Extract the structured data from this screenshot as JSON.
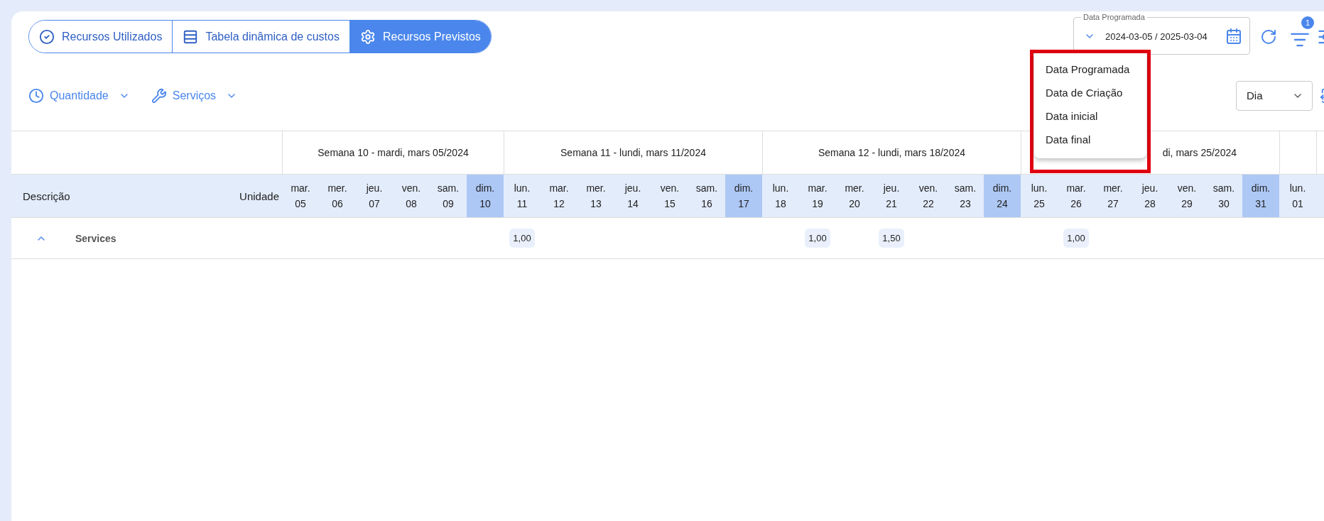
{
  "tabs": [
    {
      "label": "Recursos Utilizados",
      "selected": false
    },
    {
      "label": "Tabela dinâmica de custos",
      "selected": false
    },
    {
      "label": "Recursos Previstos",
      "selected": true
    }
  ],
  "toolbar": [
    "Quantidade",
    "Serviços"
  ],
  "date_filter": {
    "label": "Data Programada",
    "value": "2024-03-05 / 2025-03-04"
  },
  "filter_badge": "1",
  "date_menu": {
    "highlighted": true,
    "items": [
      "Data Programada",
      "Data de Criação",
      "Data inicial",
      "Data final"
    ]
  },
  "period_select": {
    "value": "Dia"
  },
  "table": {
    "columns": [
      "Descrição",
      "Unidade"
    ],
    "weeks": [
      {
        "label": "Semana 10 - mardi, mars 05/2024",
        "days": [
          {
            "weekday": "mar.",
            "day": "05",
            "weekend": false
          },
          {
            "weekday": "mer.",
            "day": "06",
            "weekend": false
          },
          {
            "weekday": "jeu.",
            "day": "07",
            "weekend": false
          },
          {
            "weekday": "ven.",
            "day": "08",
            "weekend": false
          },
          {
            "weekday": "sam.",
            "day": "09",
            "weekend": false
          },
          {
            "weekday": "dim.",
            "day": "10",
            "weekend": true
          }
        ]
      },
      {
        "label": "Semana 11 - lundi, mars 11/2024",
        "days": [
          {
            "weekday": "lun.",
            "day": "11",
            "weekend": false,
            "value": "1,00"
          },
          {
            "weekday": "mar.",
            "day": "12",
            "weekend": false
          },
          {
            "weekday": "mer.",
            "day": "13",
            "weekend": false
          },
          {
            "weekday": "jeu.",
            "day": "14",
            "weekend": false
          },
          {
            "weekday": "ven.",
            "day": "15",
            "weekend": false
          },
          {
            "weekday": "sam.",
            "day": "16",
            "weekend": false
          },
          {
            "weekday": "dim.",
            "day": "17",
            "weekend": true
          }
        ]
      },
      {
        "label": "Semana 12 - lundi, mars 18/2024",
        "days": [
          {
            "weekday": "lun.",
            "day": "18",
            "weekend": false
          },
          {
            "weekday": "mar.",
            "day": "19",
            "weekend": false,
            "value": "1,00"
          },
          {
            "weekday": "mer.",
            "day": "20",
            "weekend": false
          },
          {
            "weekday": "jeu.",
            "day": "21",
            "weekend": false,
            "value": "1,50"
          },
          {
            "weekday": "ven.",
            "day": "22",
            "weekend": false
          },
          {
            "weekday": "sam.",
            "day": "23",
            "weekend": false
          },
          {
            "weekday": "dim.",
            "day": "24",
            "weekend": true
          }
        ]
      },
      {
        "label": "di, mars 25/2024",
        "days": [
          {
            "weekday": "lun.",
            "day": "25",
            "weekend": false
          },
          {
            "weekday": "mar.",
            "day": "26",
            "weekend": false,
            "value": "1,00"
          },
          {
            "weekday": "mer.",
            "day": "27",
            "weekend": false
          },
          {
            "weekday": "jeu.",
            "day": "28",
            "weekend": false
          },
          {
            "weekday": "ven.",
            "day": "29",
            "weekend": false
          },
          {
            "weekday": "sam.",
            "day": "30",
            "weekend": false
          },
          {
            "weekday": "dim.",
            "day": "31",
            "weekend": true
          }
        ]
      },
      {
        "days": [
          {
            "weekday": "lun.",
            "day": "01",
            "weekend": false
          }
        ]
      }
    ],
    "rows": [
      {
        "label": "Services",
        "expanded": true
      }
    ]
  }
}
